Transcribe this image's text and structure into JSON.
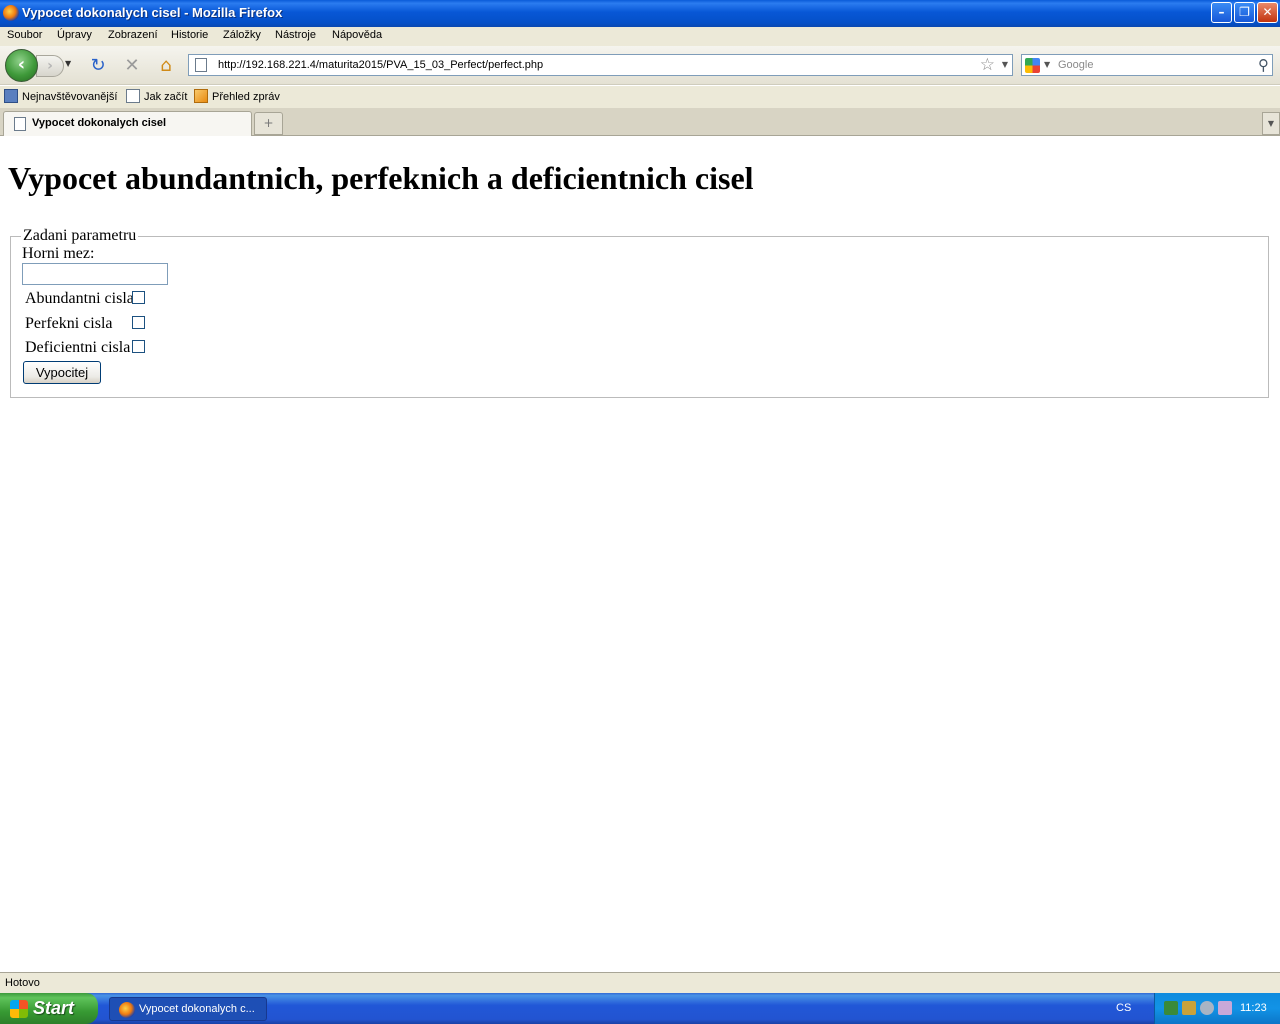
{
  "window": {
    "title": "Vypocet dokonalych cisel - Mozilla Firefox",
    "minimize_icon": "minimize-icon",
    "maximize_icon": "restore-icon",
    "close_icon": "close-icon"
  },
  "menu": [
    "Soubor",
    "Úpravy",
    "Zobrazení",
    "Historie",
    "Záložky",
    "Nástroje",
    "Nápověda"
  ],
  "toolbar": {
    "url": "http://192.168.221.4/maturita2015/PVA_15_03_Perfect/perfect.php",
    "search_placeholder": "Google"
  },
  "bookmarks": [
    "Nejnavštěvovanější",
    "Jak začít",
    "Přehled zpráv"
  ],
  "tab": {
    "title": "Vypocet dokonalych cisel",
    "new_tab_symbol": "+"
  },
  "page": {
    "heading": "Vypocet abundantnich, perfeknich a deficientnich cisel",
    "fieldset_legend": "Zadani parametru",
    "upper_limit_label": "Horni mez:",
    "upper_limit_value": "",
    "checkboxes": [
      {
        "label": "Abundantni cisla",
        "checked": false
      },
      {
        "label": "Perfekni cisla",
        "checked": false
      },
      {
        "label": "Deficientni cisla",
        "checked": false
      }
    ],
    "submit_label": "Vypocitej"
  },
  "status": {
    "text": "Hotovo"
  },
  "taskbar": {
    "start_label": "Start",
    "task_title": "Vypocet dokonalych c...",
    "language": "CS",
    "clock": "11:23"
  },
  "colors": {
    "titlebar": "#0857d6",
    "taskbar": "#2254d1",
    "start": "#379a33"
  }
}
